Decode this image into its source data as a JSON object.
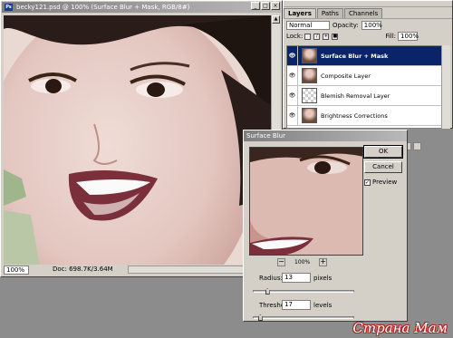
{
  "document": {
    "title": "becky121.psd @ 100% (Surface Blur + Mask, RGB/8#)",
    "zoom": "100%",
    "doc_info": "Doc: 698.7K/3.64M"
  },
  "layers_panel": {
    "tabs": [
      "Layers",
      "Paths",
      "Channels"
    ],
    "blend_mode": "Normal",
    "opacity_label": "Opacity:",
    "opacity_value": "100%",
    "lock_label": "Lock:",
    "fill_label": "Fill:",
    "fill_value": "100%",
    "layers": [
      {
        "name": "Surface Blur + Mask",
        "selected": true
      },
      {
        "name": "Composite Layer",
        "selected": false
      },
      {
        "name": "Blemish Removal Layer",
        "selected": false
      },
      {
        "name": "Brightness Corrections",
        "selected": false
      }
    ]
  },
  "dialog": {
    "title": "Surface Blur",
    "ok_label": "OK",
    "cancel_label": "Cancel",
    "preview_label": "Preview",
    "preview_checked": true,
    "zoom_level": "100%",
    "radius_label": "Radius:",
    "radius_value": "13",
    "radius_unit": "pixels",
    "threshold_label": "Threshold:",
    "threshold_value": "17",
    "threshold_unit": "levels",
    "radius_slider_fraction": 0.14,
    "threshold_slider_fraction": 0.07
  },
  "watermark": "Страна Мам",
  "colors": {
    "ui_gray": "#d4d0c8",
    "selected_layer": "#0a246a",
    "watermark_outline": "#b02020"
  }
}
